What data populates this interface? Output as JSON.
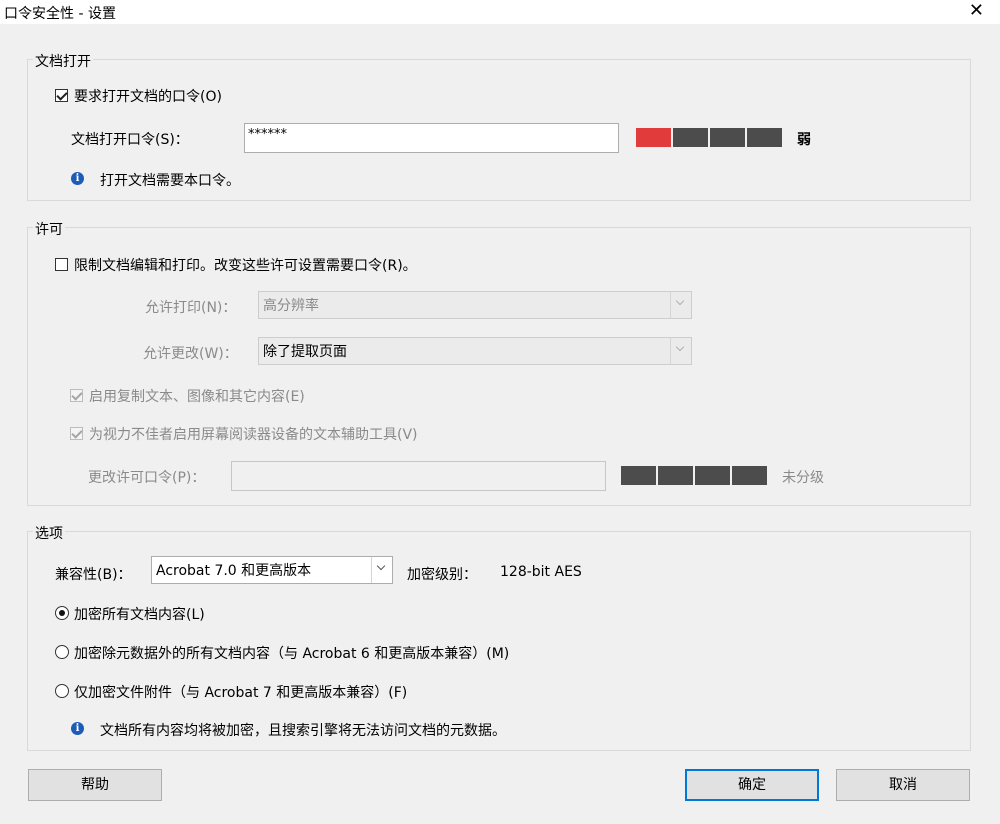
{
  "window": {
    "title": "口令安全性 - 设置",
    "close_glyph": "✕"
  },
  "doc_open": {
    "legend": "文档打开",
    "require_label": "要求打开文档的口令(O)",
    "require_checked": true,
    "password_label": "文档打开口令(S)：",
    "password_value": "******",
    "strength_level": 1,
    "strength_segments": 5,
    "strength_text": "弱",
    "info_text": "打开文档需要本口令。"
  },
  "permissions": {
    "legend": "许可",
    "restrict_label": "限制文档编辑和打印。改变这些许可设置需要口令(R)。",
    "restrict_checked": false,
    "allow_print_label": "允许打印(N)：",
    "allow_print_value": "高分辨率",
    "allow_change_label": "允许更改(W)：",
    "allow_change_value": "除了提取页面",
    "enable_copy_label": "启用复制文本、图像和其它内容(E)",
    "enable_copy_checked": true,
    "accessibility_label": "为视力不佳者启用屏幕阅读器设备的文本辅助工具(V)",
    "accessibility_checked": true,
    "change_password_label": "更改许可口令(P)：",
    "change_password_value": "",
    "strength_text": "未分级"
  },
  "options": {
    "legend": "选项",
    "compat_label": "兼容性(B)：",
    "compat_value": "Acrobat 7.0 和更高版本",
    "encrypt_level_label": "加密级别：",
    "encrypt_level_value": "128-bit AES",
    "radio_all": "加密所有文档内容(L)",
    "radio_except_meta": "加密除元数据外的所有文档内容（与 Acrobat 6 和更高版本兼容）(M)",
    "radio_attachments": "仅加密文件附件（与 Acrobat 7 和更高版本兼容）(F)",
    "selected_radio": "all",
    "info_text": "文档所有内容均将被加密，且搜索引擎将无法访问文档的元数据。"
  },
  "buttons": {
    "help": "帮助",
    "ok": "确定",
    "cancel": "取消"
  },
  "colors": {
    "weak": "#e23b3b",
    "meter_empty": "#4c4c4c",
    "accent": "#0078d7"
  },
  "icons": {
    "info": "info-icon"
  }
}
